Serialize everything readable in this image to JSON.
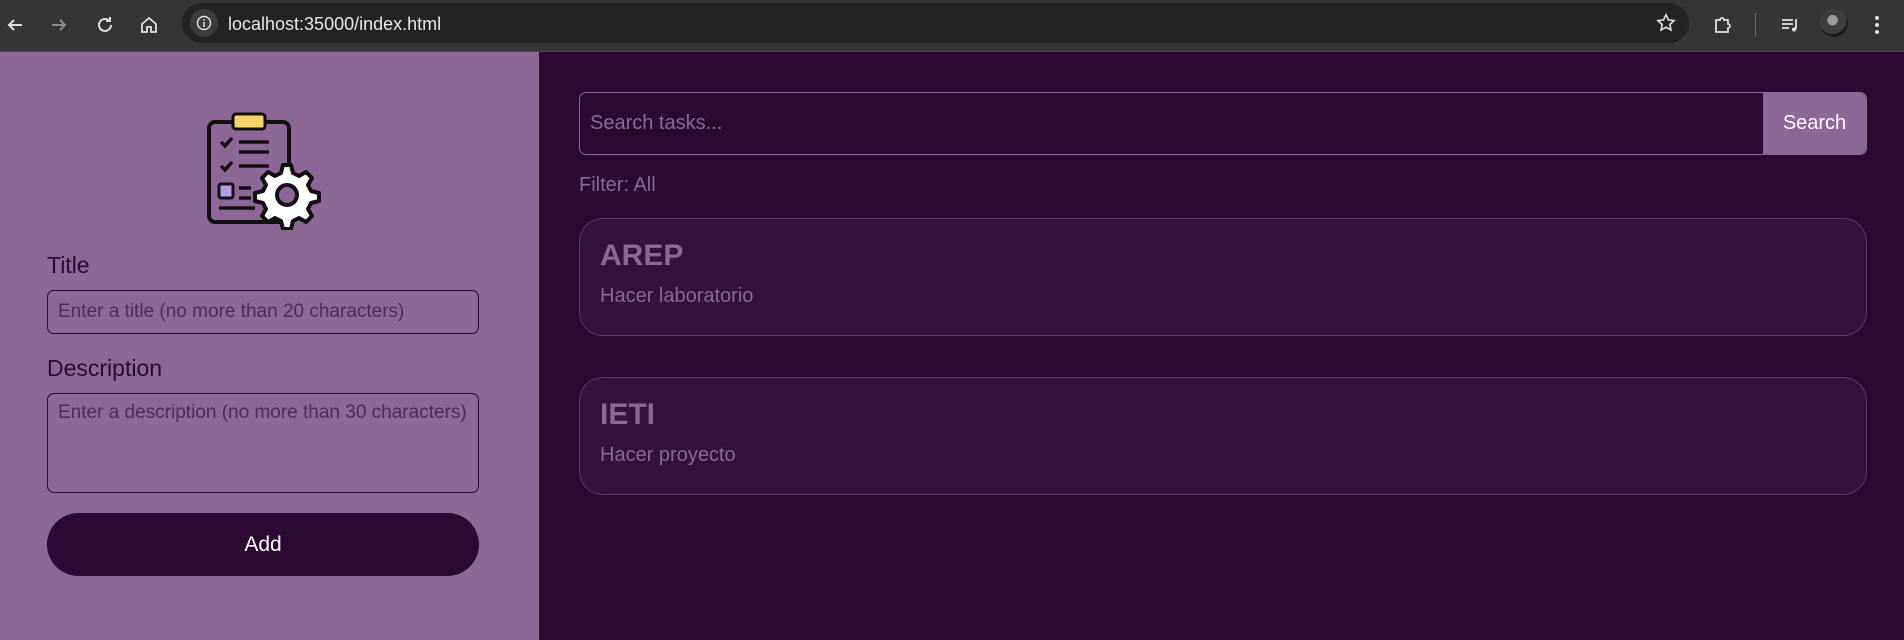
{
  "browser": {
    "url": "localhost:35000/index.html"
  },
  "form": {
    "title_label": "Title",
    "title_placeholder": "Enter a title (no more than 20 characters)",
    "description_label": "Description",
    "description_placeholder": "Enter a description (no more than 30 characters)",
    "add_label": "Add"
  },
  "search": {
    "placeholder": "Search tasks...",
    "button_label": "Search"
  },
  "filter_text": "Filter: All",
  "tasks": [
    {
      "title": "AREP",
      "description": "Hacer laboratorio"
    },
    {
      "title": "IETI",
      "description": "Hacer proyecto"
    }
  ],
  "colors": {
    "accent": "#8c6797",
    "background": "#2c0833"
  }
}
